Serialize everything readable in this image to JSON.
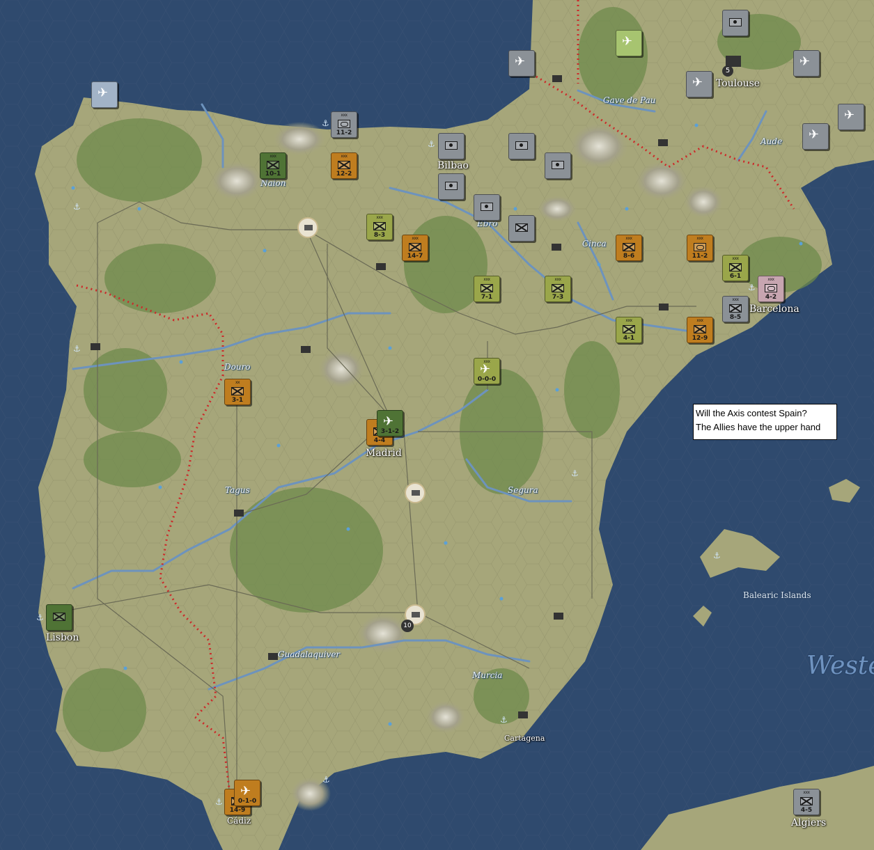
{
  "cities": [
    {
      "name": "Toulouse"
    },
    {
      "name": "Bilbao"
    },
    {
      "name": "Barcelona"
    },
    {
      "name": "Madrid"
    },
    {
      "name": "Lisbon"
    },
    {
      "name": "Cartagena"
    },
    {
      "name": "Cádiz"
    },
    {
      "name": "Algiers"
    },
    {
      "name": "Naion"
    }
  ],
  "rivers": [
    "Gave de Pau",
    "Aude",
    "Ebro",
    "Cinca",
    "Douro",
    "Tagus",
    "Segura",
    "Guadalaquiver",
    "Murcia"
  ],
  "islands": "Balearic Islands",
  "sea": "Weste",
  "city_badges": {
    "toulouse": "5",
    "south_resource": "10"
  },
  "textbox": {
    "line1": "Will the Axis contest Spain?",
    "line2": "The Allies have the upper hand"
  },
  "units": [
    {
      "id": "u1",
      "color": "grey",
      "type": "hq",
      "corps": "",
      "strength": ""
    },
    {
      "id": "u2",
      "color": "grey",
      "type": "hq",
      "corps": "",
      "strength": ""
    },
    {
      "id": "u3",
      "color": "grey",
      "type": "hq",
      "corps": "",
      "strength": ""
    },
    {
      "id": "u4",
      "color": "grey",
      "type": "hq",
      "corps": "",
      "strength": ""
    },
    {
      "id": "u5",
      "color": "grey",
      "type": "hq",
      "corps": "",
      "strength": ""
    },
    {
      "id": "u6",
      "color": "grey",
      "type": "hq",
      "corps": "",
      "strength": ""
    },
    {
      "id": "u7",
      "color": "grey",
      "type": "inf",
      "corps": "",
      "strength": ""
    },
    {
      "id": "u8",
      "color": "grey",
      "type": "arm",
      "corps": "xxx",
      "strength": "11-2"
    },
    {
      "id": "u9",
      "color": "dgreen",
      "type": "inf",
      "corps": "xxx",
      "strength": "10-1"
    },
    {
      "id": "u10",
      "color": "orange",
      "type": "inf",
      "corps": "xxx",
      "strength": "12-2"
    },
    {
      "id": "u11",
      "color": "green",
      "type": "inf",
      "corps": "xxx",
      "strength": "8-3"
    },
    {
      "id": "u12",
      "color": "orange",
      "type": "inf",
      "corps": "xxx",
      "strength": "14-7"
    },
    {
      "id": "u13",
      "color": "green",
      "type": "inf",
      "corps": "xxx",
      "strength": "7-1"
    },
    {
      "id": "u14",
      "color": "green",
      "type": "inf",
      "corps": "xxx",
      "strength": "7-3"
    },
    {
      "id": "u15",
      "color": "orange",
      "type": "inf",
      "corps": "xxx",
      "strength": "8-6"
    },
    {
      "id": "u16",
      "color": "orange",
      "type": "arm",
      "corps": "xxx",
      "strength": "11-2"
    },
    {
      "id": "u17",
      "color": "green",
      "type": "inf",
      "corps": "xxx",
      "strength": "6-1"
    },
    {
      "id": "u18",
      "color": "pink",
      "type": "arm",
      "corps": "xxx",
      "strength": "4-2"
    },
    {
      "id": "u19",
      "color": "grey",
      "type": "inf",
      "corps": "xxx",
      "strength": "8-5"
    },
    {
      "id": "u20",
      "color": "green",
      "type": "inf",
      "corps": "xxx",
      "strength": "4-1"
    },
    {
      "id": "u21",
      "color": "orange",
      "type": "inf",
      "corps": "xxx",
      "strength": "12-9"
    },
    {
      "id": "u22",
      "color": "green",
      "type": "plane",
      "corps": "xxx",
      "strength": "0-0-0"
    },
    {
      "id": "u23",
      "color": "orange",
      "type": "inf",
      "corps": "xx",
      "strength": "3-1"
    },
    {
      "id": "u24",
      "color": "orange",
      "type": "inf",
      "corps": "xxx",
      "strength": "4-4"
    },
    {
      "id": "u25",
      "color": "dgreen",
      "type": "plane",
      "corps": "",
      "strength": "3-1-2"
    },
    {
      "id": "u26",
      "color": "dgreen",
      "type": "inf",
      "corps": "",
      "strength": ""
    },
    {
      "id": "u27",
      "color": "orange",
      "type": "inf",
      "corps": "",
      "strength": "14-9"
    },
    {
      "id": "u28",
      "color": "orange",
      "type": "plane",
      "corps": "",
      "strength": "0-1-0"
    },
    {
      "id": "u29",
      "color": "grey",
      "type": "inf",
      "corps": "xxx",
      "strength": "4-5"
    },
    {
      "id": "u30",
      "color": "lgreen",
      "type": "plane",
      "corps": "",
      "strength": ""
    },
    {
      "id": "u31",
      "color": "grey",
      "type": "plane",
      "corps": "",
      "strength": ""
    },
    {
      "id": "u32",
      "color": "grey",
      "type": "plane",
      "corps": "",
      "strength": ""
    },
    {
      "id": "u33",
      "color": "grey",
      "type": "plane",
      "corps": "",
      "strength": ""
    },
    {
      "id": "u34",
      "color": "grey",
      "type": "plane",
      "corps": "",
      "strength": ""
    },
    {
      "id": "u35",
      "color": "grey",
      "type": "plane",
      "corps": "",
      "strength": ""
    },
    {
      "id": "u36",
      "color": "blue",
      "type": "plane",
      "corps": "",
      "strength": ""
    }
  ],
  "colors": {
    "sea": "#2f4a6e",
    "land": "#a6a67a",
    "forest": "#6e8a4c",
    "border": "#cc2a2a",
    "river": "#6d93bd"
  }
}
